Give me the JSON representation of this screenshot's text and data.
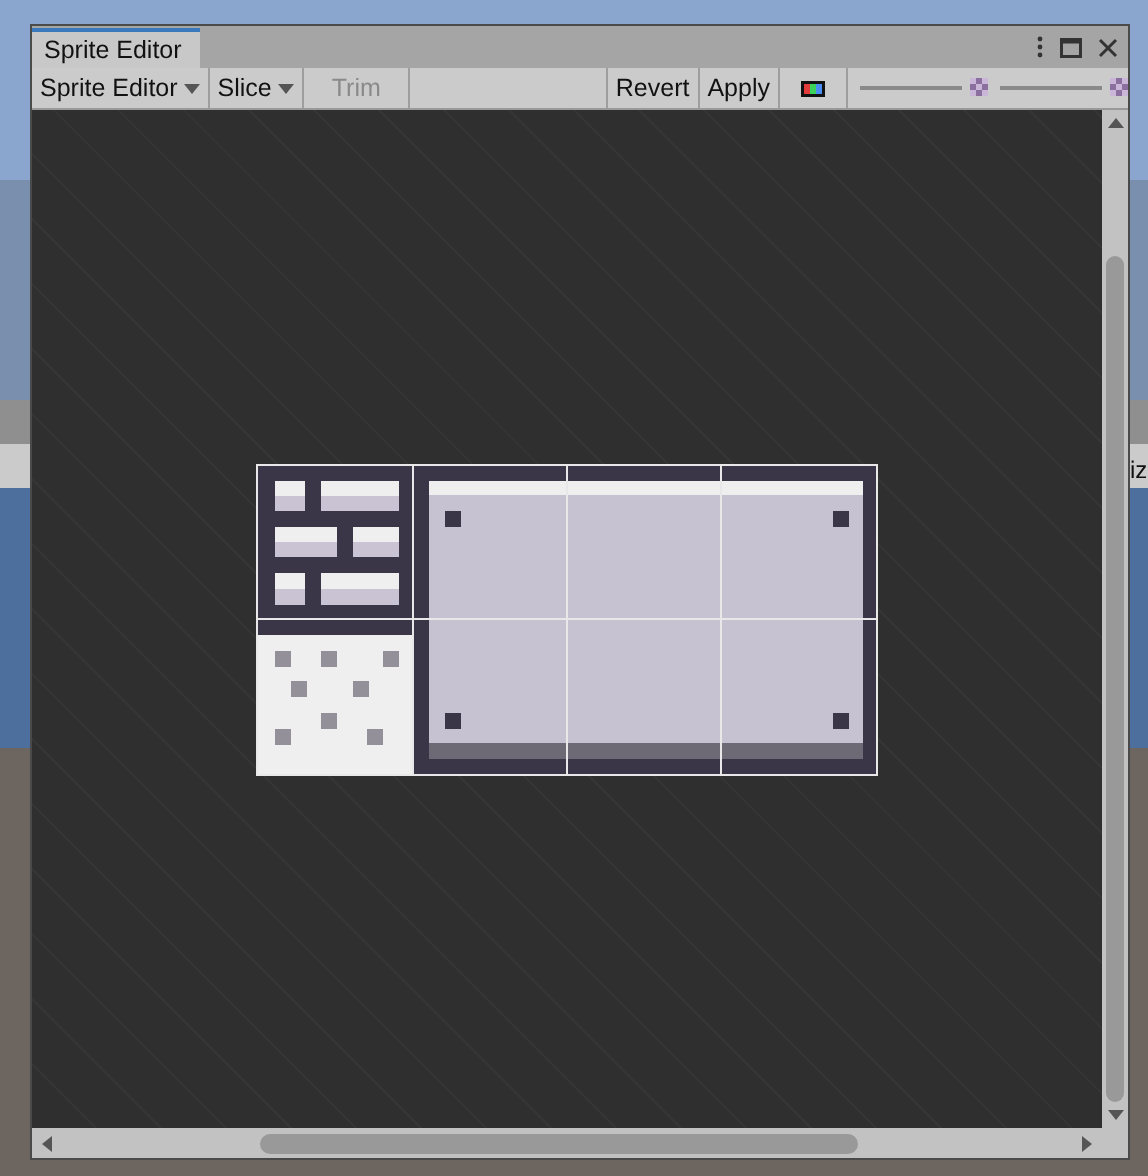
{
  "window": {
    "tab": {
      "label": "Sprite Editor",
      "selected": true
    }
  },
  "toolbar": [
    {
      "kind": "dropdown",
      "label": "Sprite Editor",
      "disabled": false
    },
    {
      "kind": "dropdown",
      "label": "Slice",
      "disabled": false
    },
    {
      "kind": "button",
      "label": "Trim",
      "disabled": true
    },
    {
      "kind": "spacer"
    },
    {
      "kind": "button",
      "label": "Revert",
      "disabled": false
    },
    {
      "kind": "button",
      "label": "Apply",
      "disabled": false
    },
    {
      "kind": "channels"
    },
    {
      "kind": "slider"
    },
    {
      "kind": "slider"
    }
  ],
  "background": {
    "partial_label": "iz"
  }
}
